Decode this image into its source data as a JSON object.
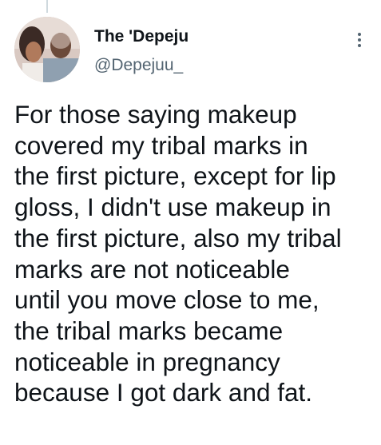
{
  "tweet": {
    "author": {
      "display_name": "The 'Depeju",
      "handle": "@Depejuu_",
      "avatar_icon": "profile-photo"
    },
    "more_icon": "more-vertical-icon",
    "text": "For those saying makeup\ncovered my tribal marks in\nthe first picture, except for lip\ngloss, I didn't use makeup in\nthe first picture, also my tribal\nmarks are not noticeable\nuntil you move close to me,\nthe tribal marks became\nnoticeable in pregnancy\nbecause I got dark and fat."
  },
  "colors": {
    "text": "#0f1419",
    "secondary_text": "#536471",
    "thread_line": "#cfd9de",
    "background": "#ffffff"
  }
}
